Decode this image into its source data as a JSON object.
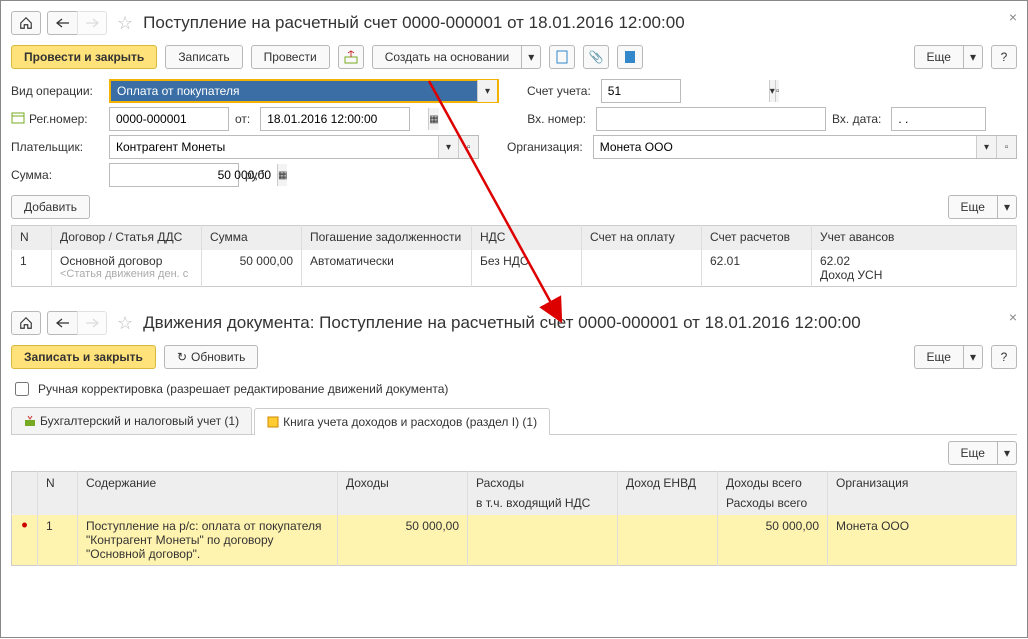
{
  "top": {
    "title": "Поступление на расчетный счет 0000-000001 от 18.01.2016 12:00:00",
    "toolbar": {
      "post_close": "Провести и закрыть",
      "save": "Записать",
      "post": "Провести",
      "create_based": "Создать на основании",
      "more": "Еще",
      "help": "?"
    },
    "form": {
      "op_type_label": "Вид операции:",
      "op_type_value": "Оплата от покупателя",
      "account_label": "Счет учета:",
      "account_value": "51",
      "reg_label": "Рег.номер:",
      "reg_value": "0000-000001",
      "from_label": "от:",
      "date_value": "18.01.2016 12:00:00",
      "in_num_label": "Вх. номер:",
      "in_date_label": "Вх. дата:",
      "in_date_value": ". .",
      "payer_label": "Плательщик:",
      "payer_value": "Контрагент Монеты",
      "org_label": "Организация:",
      "org_value": "Монета ООО",
      "sum_label": "Сумма:",
      "sum_value": "50 000,00",
      "currency": "руб.",
      "add": "Добавить",
      "more2": "Еще"
    },
    "table": {
      "headers": {
        "n": "N",
        "contract": "Договор / Статья ДДС",
        "sum": "Сумма",
        "repay": "Погашение задолженности",
        "vat": "НДС",
        "invoice": "Счет на оплату",
        "acc": "Счет расчетов",
        "adv": "Учет авансов"
      },
      "row": {
        "n": "1",
        "contract": "Основной договор",
        "contract_sub": "<Статья движения ден. с",
        "sum": "50 000,00",
        "repay": "Автоматически",
        "vat": "Без НДС",
        "acc": "62.01",
        "adv1": "62.02",
        "adv2": "Доход УСН"
      }
    }
  },
  "bottom": {
    "title": "Движения документа: Поступление на расчетный счет 0000-000001 от 18.01.2016 12:00:00",
    "toolbar": {
      "save_close": "Записать и закрыть",
      "refresh": "Обновить",
      "more": "Еще",
      "help": "?"
    },
    "manual_label": "Ручная корректировка (разрешает редактирование движений документа)",
    "tabs": {
      "t1": "Бухгалтерский и налоговый учет (1)",
      "t2": "Книга учета доходов и расходов (раздел I) (1)"
    },
    "more": "Еще",
    "table": {
      "headers": {
        "n": "N",
        "content": "Содержание",
        "income": "Доходы",
        "expense": "Расходы",
        "expense_sub": "в т.ч. входящий НДС",
        "envd": "Доход ЕНВД",
        "income_total": "Доходы всего",
        "outcome_total": "Расходы всего",
        "org": "Организация"
      },
      "row": {
        "n": "1",
        "content": "Поступление на р/с: оплата от покупателя \"Контрагент Монеты\" по договору \"Основной договор\".",
        "income": "50 000,00",
        "income_total": "50 000,00",
        "org": "Монета ООО"
      }
    }
  }
}
